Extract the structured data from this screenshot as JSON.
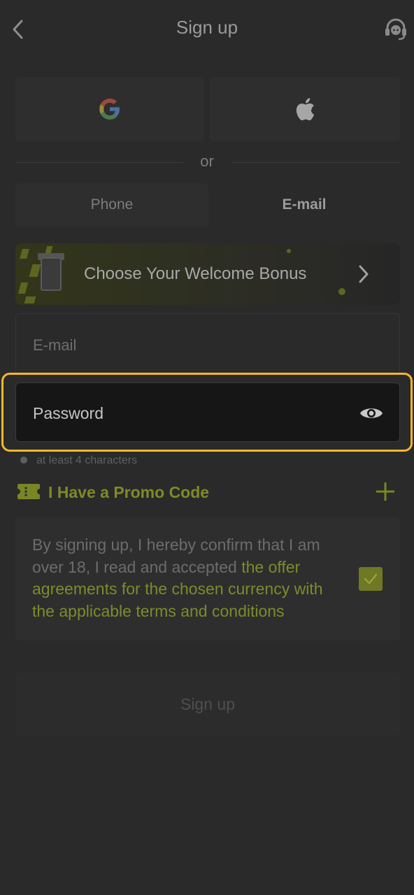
{
  "header": {
    "title": "Sign up",
    "back_icon": "chevron-left-icon",
    "support_icon": "headset-icon"
  },
  "social": {
    "google_icon": "google-icon",
    "apple_icon": "apple-icon",
    "separator": "or"
  },
  "tabs": [
    {
      "label": "Phone",
      "active": false
    },
    {
      "label": "E-mail",
      "active": true
    }
  ],
  "bonus": {
    "label": "Choose Your Welcome Bonus",
    "chevron_icon": "chevron-right-icon"
  },
  "form": {
    "email_placeholder": "E-mail",
    "password_placeholder": "Password",
    "password_hint": "at least 4 characters",
    "eye_icon": "eye-icon"
  },
  "promo": {
    "label": "I Have a Promo Code",
    "icon": "ticket-icon",
    "add_icon": "plus-icon"
  },
  "terms": {
    "text": "By signing up, I hereby confirm that I am over 18, I read and accepted ",
    "link": "the offer agreements for the chosen currency with the applicable terms and conditions",
    "checked": true
  },
  "signup_button": "Sign up",
  "colors": {
    "background": "#2a2a2a",
    "accent": "#7e8b2b",
    "highlight": "#f5b82a"
  }
}
